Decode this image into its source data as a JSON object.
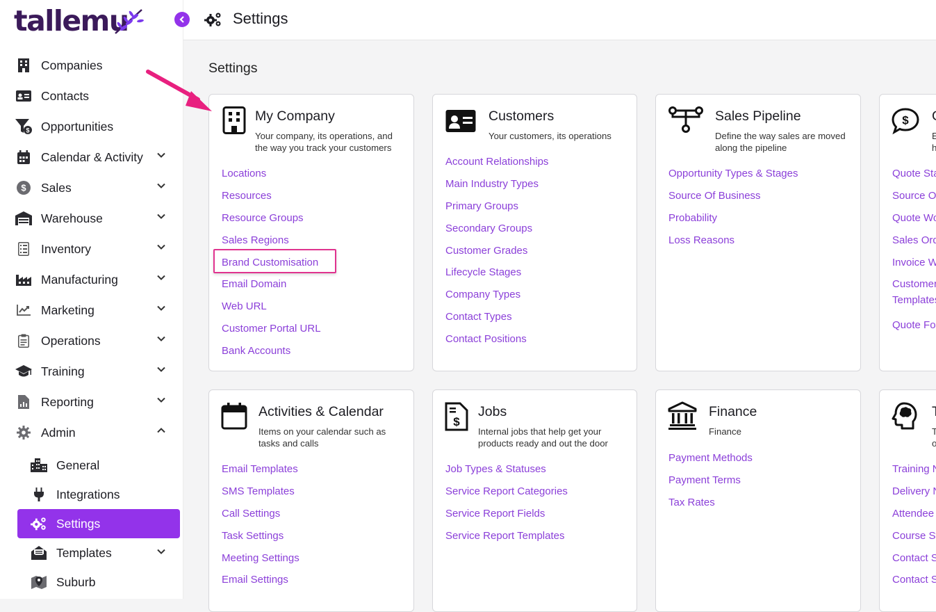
{
  "logo": {
    "text": "tallemu"
  },
  "topbar": {
    "title": "Settings"
  },
  "sidebar": {
    "items": [
      {
        "label": "Companies",
        "icon": "building-icon",
        "expandable": false
      },
      {
        "label": "Contacts",
        "icon": "id-card-icon",
        "expandable": false
      },
      {
        "label": "Opportunities",
        "icon": "funnel-dollar-icon",
        "expandable": false
      },
      {
        "label": "Calendar & Activity",
        "icon": "calendar-icon",
        "expandable": true
      },
      {
        "label": "Sales",
        "icon": "dollar-coin-icon",
        "expandable": true
      },
      {
        "label": "Warehouse",
        "icon": "warehouse-icon",
        "expandable": true
      },
      {
        "label": "Inventory",
        "icon": "clipboard-list-icon",
        "expandable": true
      },
      {
        "label": "Manufacturing",
        "icon": "factory-icon",
        "expandable": true
      },
      {
        "label": "Marketing",
        "icon": "chart-line-icon",
        "expandable": true
      },
      {
        "label": "Operations",
        "icon": "clipboard-check-icon",
        "expandable": true
      },
      {
        "label": "Training",
        "icon": "graduation-cap-icon",
        "expandable": true
      },
      {
        "label": "Reporting",
        "icon": "report-chart-icon",
        "expandable": true
      },
      {
        "label": "Admin",
        "icon": "cog-icon",
        "expandable": true,
        "expanded": true
      }
    ],
    "admin_sub": [
      {
        "label": "General",
        "icon": "city-icon"
      },
      {
        "label": "Integrations",
        "icon": "plug-icon"
      },
      {
        "label": "Settings",
        "icon": "cogs-icon",
        "active": true
      },
      {
        "label": "Templates",
        "icon": "envelope-open-icon",
        "expandable": true
      },
      {
        "label": "Suburb",
        "icon": "map-marker-icon"
      }
    ]
  },
  "main": {
    "section_title": "Settings",
    "cards": [
      {
        "title": "My Company",
        "desc_line1": "Your company, its operations, and",
        "desc_line2": "the way you track your customers",
        "links": [
          "Locations",
          "Resources",
          "Resource Groups",
          "Sales Regions",
          "Brand Customisation",
          "Email Domain",
          "Web URL",
          "Customer Portal URL",
          "Bank Accounts"
        ]
      },
      {
        "title": "Customers",
        "desc_line1": "Your customers, its operations",
        "desc_line2": "",
        "links": [
          "Account Relationships",
          "Main Industry Types",
          "Primary Groups",
          "Secondary Groups",
          "Customer Grades",
          "Lifecycle Stages",
          "Company Types",
          "Contact Types",
          "Contact Positions"
        ]
      },
      {
        "title": "Sales Pipeline",
        "desc_line1": "Define the way sales are moved",
        "desc_line2": "along the pipeline",
        "links": [
          "Opportunity Types & Stages",
          "Source Of Business",
          "Probability",
          "Loss Reasons"
        ]
      },
      {
        "title": "C",
        "desc_line1": "E",
        "desc_line2": "h",
        "links": [
          "Quote Sta",
          "Source Of",
          "Quote Wo",
          "Sales Ord",
          "Invoice W",
          "Customer",
          "Templates",
          "Quote Fo"
        ]
      },
      {
        "title": "Activities & Calendar",
        "desc_line1": "Items on your calendar such as",
        "desc_line2": "tasks and calls",
        "links": [
          "Email Templates",
          "SMS Templates",
          "Call Settings",
          "Task Settings",
          "Meeting Settings",
          "Email Settings"
        ]
      },
      {
        "title": "Jobs",
        "desc_line1": "Internal jobs that help get your",
        "desc_line2": "products ready and out the door",
        "links": [
          "Job Types & Statuses",
          "Service Report Categories",
          "Service Report Fields",
          "Service Report Templates"
        ]
      },
      {
        "title": "Finance",
        "desc_line1": "Finance",
        "desc_line2": "",
        "links": [
          "Payment Methods",
          "Payment Terms",
          "Tax Rates"
        ]
      },
      {
        "title": "T",
        "desc_line1": "T",
        "desc_line2": "o",
        "links": [
          "Training N",
          "Delivery N",
          "Attendee",
          "Course St",
          "Contact S",
          "Contact St"
        ]
      }
    ]
  },
  "colors": {
    "accent": "#9333ea",
    "link": "#8b3fd9",
    "highlight": "#e0338f"
  }
}
